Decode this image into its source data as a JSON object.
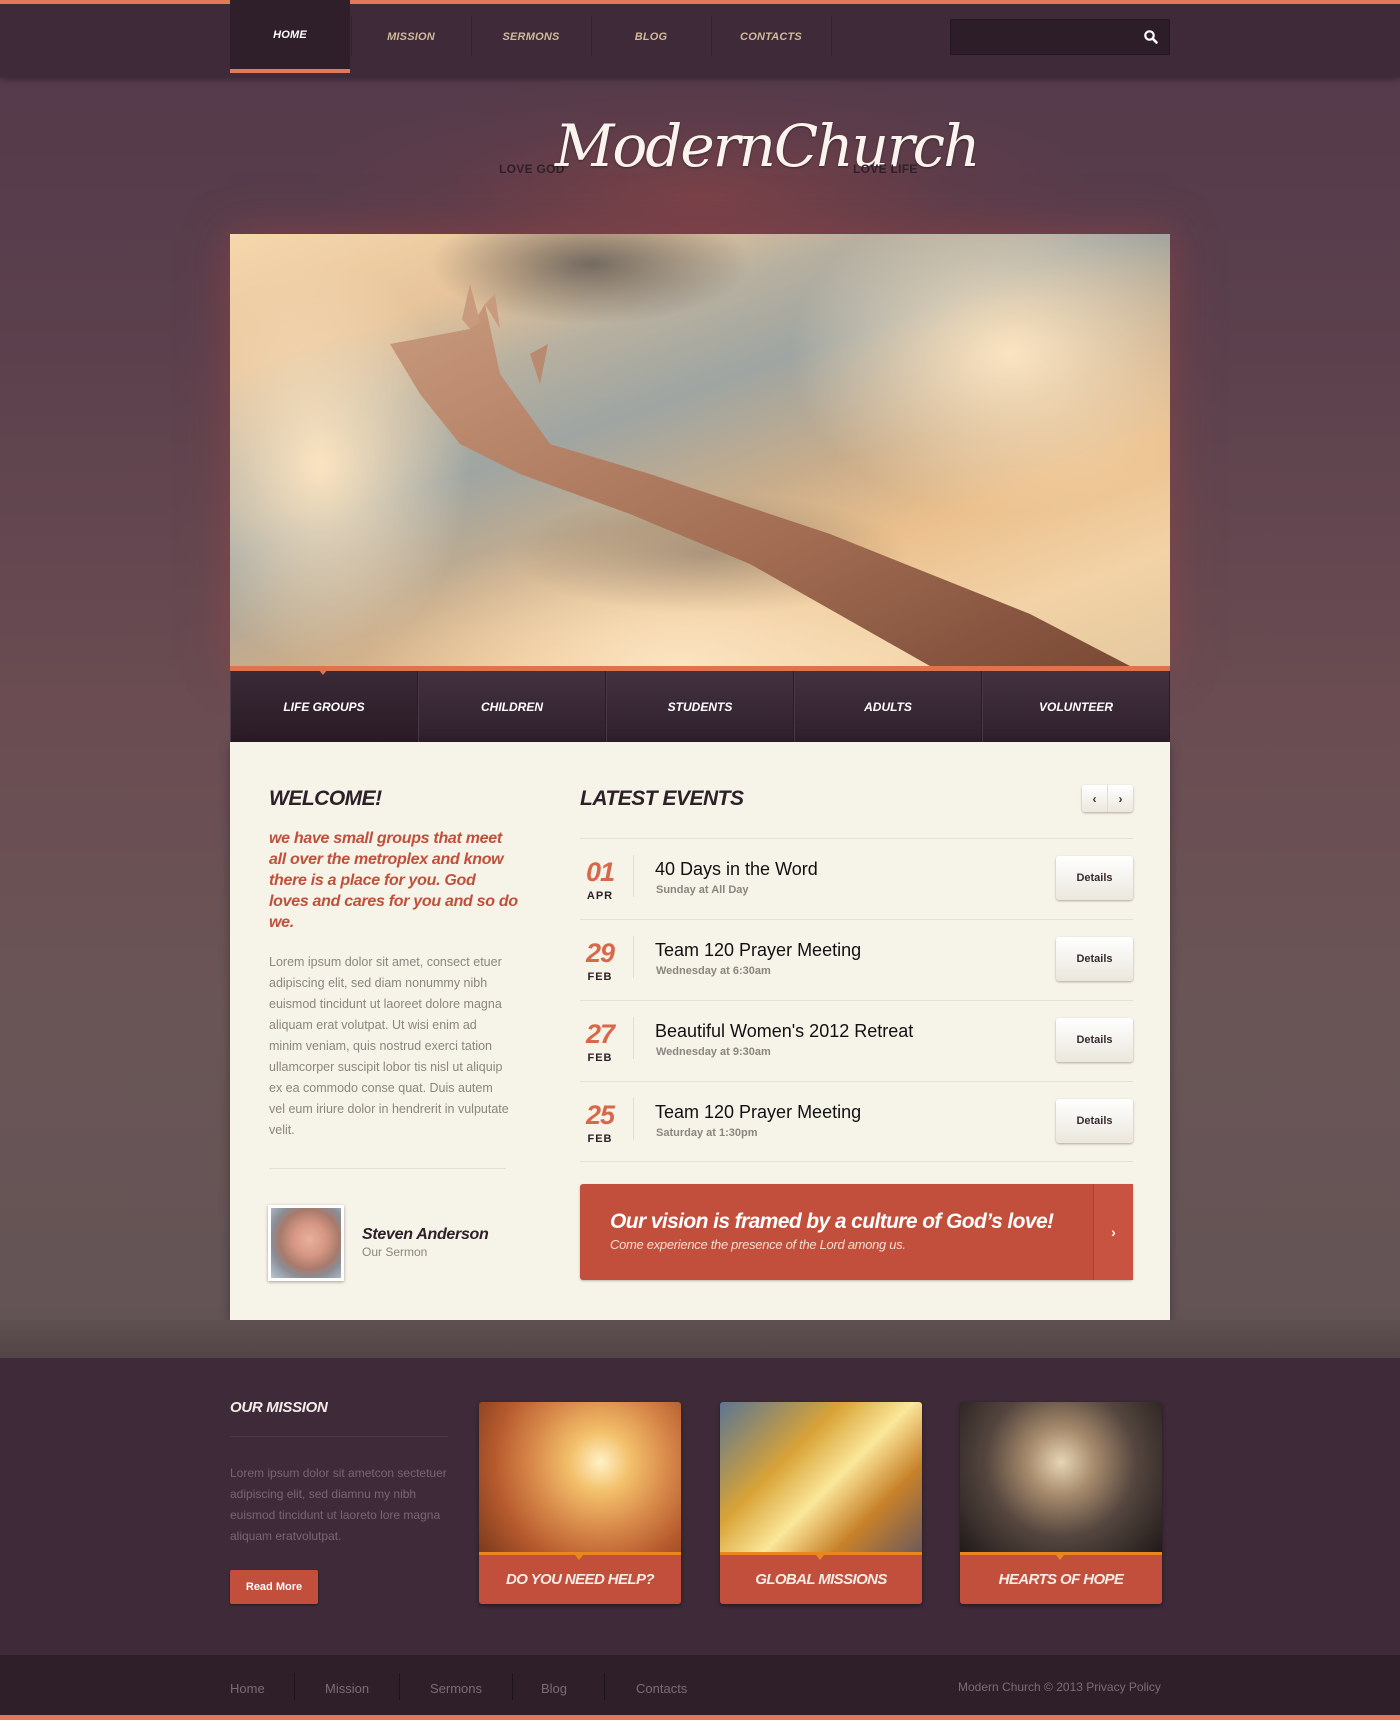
{
  "nav": {
    "items": [
      {
        "label": "Home",
        "active": true
      },
      {
        "label": "Mission",
        "active": false
      },
      {
        "label": "Sermons",
        "active": false
      },
      {
        "label": "Blog",
        "active": false
      },
      {
        "label": "Contacts",
        "active": false
      }
    ],
    "search_placeholder": "",
    "search_icon": "search-icon"
  },
  "header": {
    "tag_left": "LOVE GOD",
    "logo": "ModernChurch",
    "tag_right": "LOVE LIFE"
  },
  "hero": {
    "image": "hand reaching toward cloudy sky"
  },
  "subtabs": [
    {
      "label": "Life Groups",
      "active": true
    },
    {
      "label": "Children",
      "active": false
    },
    {
      "label": "Students",
      "active": false
    },
    {
      "label": "Adults",
      "active": false
    },
    {
      "label": "Volunteer",
      "active": false
    }
  ],
  "welcome": {
    "heading": "WELCOME!",
    "lead": "we have small groups that meet all over the metroplex and know there is a place for you. God loves and cares for you and so do we.",
    "body": "Lorem ipsum dolor sit amet, consect etuer adipiscing elit, sed diam nonummy nibh euismod tincidunt ut laoreet dolore magna aliquam erat volutpat. Ut wisi enim ad minim veniam, quis nostrud exerci tation ullamcorper suscipit lobor tis nisl ut aliquip ex ea commodo conse quat. Duis autem vel eum iriure dolor in hendrerit in vulputate velit.",
    "author": {
      "name": "Steven Anderson",
      "role": "Our Sermon"
    }
  },
  "events": {
    "heading": "LATEST EVENTS",
    "prev": "‹",
    "next": "›",
    "items": [
      {
        "day": "01",
        "month": "APR",
        "title": "40 Days in the Word",
        "when": "Sunday at All Day",
        "button": "Details"
      },
      {
        "day": "29",
        "month": "FEB",
        "title": "Team 120 Prayer Meeting",
        "when": "Wednesday at 6:30am",
        "button": "Details"
      },
      {
        "day": "27",
        "month": "FEB",
        "title": "Beautiful Women's 2012 Retreat",
        "when": "Wednesday at 9:30am",
        "button": "Details"
      },
      {
        "day": "25",
        "month": "FEB",
        "title": "Team 120 Prayer Meeting",
        "when": "Saturday at 1:30pm",
        "button": "Details"
      }
    ]
  },
  "vision": {
    "title": "Our vision is framed by a culture of God’s love!",
    "subtitle": "Come experience the presence of the Lord among us.",
    "arrow": "›"
  },
  "mission": {
    "heading": "OUR MISSION",
    "text": "Lorem ipsum dolor sit ametcon sectetuer adipiscing elit, sed diamnu my nibh euismod tincidunt ut laoreto lore magna aliquam eratvolutpat.",
    "button": "Read More",
    "cards": [
      {
        "label": "Do you need help?"
      },
      {
        "label": "Global Missions"
      },
      {
        "label": "Hearts of Hope"
      }
    ]
  },
  "footer": {
    "links": [
      "Home",
      "Mission",
      "Sermons",
      "Blog",
      "Contacts"
    ],
    "copyright": "Modern Church © 2013 Privacy Policy"
  },
  "colors": {
    "accent": "#e07a58",
    "brand_red": "#c24f3c",
    "nav_bg": "#3e2a38",
    "panel_bg": "#f6f3e8",
    "date_color": "#d7684b"
  }
}
